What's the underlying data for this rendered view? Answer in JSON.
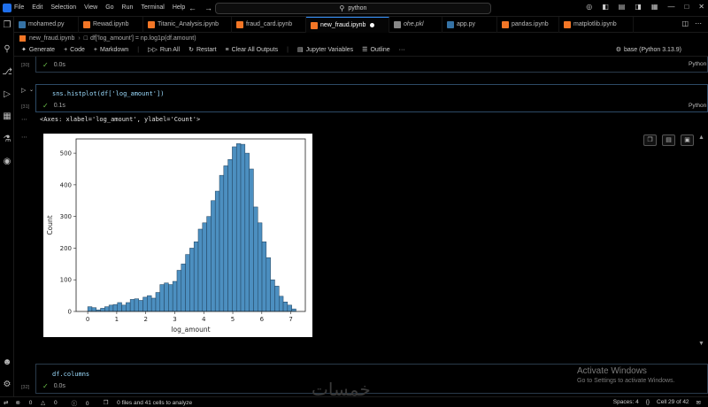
{
  "menu": [
    "File",
    "Edit",
    "Selection",
    "View",
    "Go",
    "Run",
    "Terminal",
    "Help"
  ],
  "search": {
    "text": "python"
  },
  "tabs": [
    {
      "label": "mohamed.py",
      "color": "#3572A5"
    },
    {
      "label": "Rewad.ipynb",
      "color": "#f37626"
    },
    {
      "label": "Titanic_Analysis.ipynb",
      "color": "#f37626"
    },
    {
      "label": "fraud_card.ipynb",
      "color": "#f37626"
    },
    {
      "label": "new_fraud.ipynb",
      "color": "#f37626",
      "active": true,
      "dirty": true
    },
    {
      "label": "ohe.pkl",
      "color": "#888888"
    },
    {
      "label": "app.py",
      "color": "#3572A5"
    },
    {
      "label": "pandas.ipynb",
      "color": "#f37626"
    },
    {
      "label": "matplotlib.ipynb",
      "color": "#f37626"
    }
  ],
  "breadcrumb": {
    "file": "new_fraud.ipynb",
    "cell": "df['log_amount'] = np.log1p(df.amount)"
  },
  "toolbar": {
    "generate": "Generate",
    "code": "Code",
    "markdown": "Markdown",
    "run_all": "Run All",
    "restart": "Restart",
    "clear": "Clear All Outputs",
    "variables": "Jupyter Variables",
    "outline": "Outline",
    "more": "···",
    "kernel": "base (Python 3.13.9)"
  },
  "cells": {
    "c30": {
      "num": "[30]",
      "time": "0.0s",
      "lang": "Python"
    },
    "c31": {
      "num": "[31]",
      "code": "sns.histplot(df['log_amount'])",
      "time": "0.1s",
      "lang": "Python",
      "output_text": "<Axes: xlabel='log_amount', ylabel='Count'>"
    },
    "c32": {
      "num": "[32]",
      "code": "df.columns",
      "time": "0.0s"
    }
  },
  "chart_data": {
    "type": "bar",
    "xlabel": "log_amount",
    "ylabel": "Count",
    "xlim": [
      -0.4,
      7.5
    ],
    "ylim": [
      0,
      545
    ],
    "xticks": [
      0,
      1,
      2,
      3,
      4,
      5,
      6,
      7
    ],
    "yticks": [
      0,
      100,
      200,
      300,
      400,
      500
    ],
    "bin_start": 0.0,
    "bin_width": 0.1465,
    "values": [
      15,
      12,
      5,
      10,
      15,
      20,
      22,
      28,
      20,
      28,
      38,
      40,
      35,
      45,
      50,
      42,
      60,
      85,
      90,
      85,
      95,
      130,
      150,
      180,
      200,
      220,
      260,
      280,
      300,
      350,
      380,
      430,
      460,
      480,
      520,
      530,
      528,
      500,
      450,
      330,
      280,
      220,
      170,
      100,
      80,
      48,
      30,
      20,
      8
    ],
    "color": "#4c8fc0"
  },
  "watermark": {
    "title": "Activate Windows",
    "sub": "Go to Settings to activate Windows."
  },
  "arabic_logo": "خمسات",
  "statusbar": {
    "errors": "0",
    "warnings": "0",
    "info": "0",
    "analysis": "0 files and 41 cells to analyze",
    "spaces": "Spaces: 4",
    "cell": "Cell 29 of 42"
  }
}
